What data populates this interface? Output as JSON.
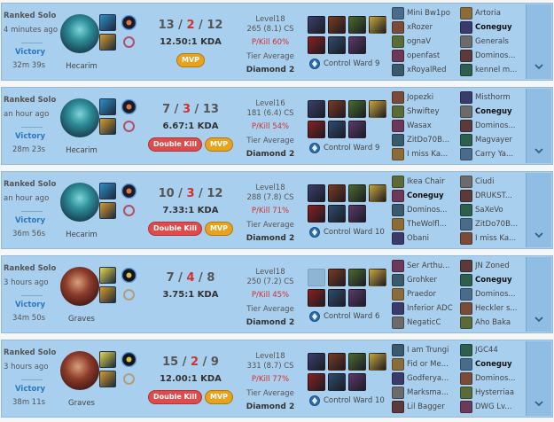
{
  "colors": {
    "win_bg": "#a9cfee",
    "victory": "#2c76c3",
    "deaths": "#d32f2f",
    "kill_participation": "#d32f2f",
    "mvp_badge": "#e9a21c",
    "multikill_badge": "#e04a4a"
  },
  "matches": [
    {
      "queue": "Ranked Solo",
      "time_ago": "4 minutes ago",
      "result": "Victory",
      "duration": "32m 39s",
      "champion": "Hecarim",
      "spells": [
        "ghost-spell-icon",
        "smite-spell-icon"
      ],
      "runes": [
        "conqueror-rune-icon",
        "sorcery-rune-icon"
      ],
      "kills": "13",
      "deaths": "2",
      "assists": "12",
      "kda": "12.50:1 KDA",
      "badges": [
        {
          "label": "MVP",
          "type": "mvp"
        }
      ],
      "level": "Level18",
      "cs": "265 (8.1) CS",
      "pkill": "P/Kill 60%",
      "tier_label": "Tier Average",
      "tier": "Diamond 2",
      "items": [
        "item-1-icon",
        "item-2-icon",
        "item-3-icon",
        "trinket-icon",
        "item-4-icon",
        "item-5-icon",
        "item-6-icon"
      ],
      "ward": "Control Ward 9",
      "team1": [
        "Mini Bw1po",
        "xRozer",
        "ognaV",
        "openfast",
        "xRoyalRed"
      ],
      "team2": [
        "Ártoria",
        "Coneguy",
        "Generals",
        "Dominos...",
        "kennel m..."
      ]
    },
    {
      "queue": "Ranked Solo",
      "time_ago": "an hour ago",
      "result": "Victory",
      "duration": "28m 23s",
      "champion": "Hecarim",
      "spells": [
        "ghost-spell-icon",
        "smite-spell-icon"
      ],
      "runes": [
        "conqueror-rune-icon",
        "sorcery-rune-icon"
      ],
      "kills": "7",
      "deaths": "3",
      "assists": "13",
      "kda": "6.67:1 KDA",
      "badges": [
        {
          "label": "Double Kill",
          "type": "multi"
        },
        {
          "label": "MVP",
          "type": "mvp"
        }
      ],
      "level": "Level16",
      "cs": "181 (6.4) CS",
      "pkill": "P/Kill 54%",
      "tier_label": "Tier Average",
      "tier": "Diamond 2",
      "items": [
        "item-1-icon",
        "item-2-icon",
        "item-3-icon",
        "trinket-icon",
        "item-4-icon",
        "item-5-icon",
        "item-6-icon"
      ],
      "ward": "Control Ward 9",
      "team1": [
        "Jopezki",
        "Shwiftey",
        "Wasax",
        "ŽitDo70B...",
        "I miss Ka..."
      ],
      "team2": [
        "Misthorm",
        "Coneguy",
        "Dominos...",
        "Magvayer",
        "Carry Ya..."
      ]
    },
    {
      "queue": "Ranked Solo",
      "time_ago": "an hour ago",
      "result": "Victory",
      "duration": "36m 56s",
      "champion": "Hecarim",
      "spells": [
        "ghost-spell-icon",
        "smite-spell-icon"
      ],
      "runes": [
        "conqueror-rune-icon",
        "sorcery-rune-icon"
      ],
      "kills": "10",
      "deaths": "3",
      "assists": "12",
      "kda": "7.33:1 KDA",
      "badges": [
        {
          "label": "Double Kill",
          "type": "multi"
        },
        {
          "label": "MVP",
          "type": "mvp"
        }
      ],
      "level": "Level18",
      "cs": "288 (7.8) CS",
      "pkill": "P/Kill 71%",
      "tier_label": "Tier Average",
      "tier": "Diamond 2",
      "items": [
        "item-1-icon",
        "item-2-icon",
        "item-3-icon",
        "trinket-icon",
        "item-4-icon",
        "item-5-icon",
        "item-6-icon"
      ],
      "ward": "Control Ward 10",
      "team1": [
        "Ikea Chair",
        "Coneguy",
        "Dominos...",
        "TheWolfl...",
        "Obani"
      ],
      "team2": [
        "Ciudi",
        "DRUKST...",
        "SaXeVo",
        "ŽitDo70B...",
        "I miss Ka..."
      ]
    },
    {
      "queue": "Ranked Solo",
      "time_ago": "3 hours ago",
      "result": "Victory",
      "duration": "34m 50s",
      "champion": "Graves",
      "spells": [
        "flash-spell-icon",
        "smite-spell-icon"
      ],
      "runes": [
        "fleet-rune-icon",
        "precision-rune-icon"
      ],
      "kills": "7",
      "deaths": "4",
      "assists": "8",
      "kda": "3.75:1 KDA",
      "badges": [],
      "level": "Level18",
      "cs": "250 (7.2) CS",
      "pkill": "P/Kill 45%",
      "tier_label": "Tier Average",
      "tier": "Diamond 2",
      "items": [
        "empty",
        "item-2-icon",
        "item-3-icon",
        "trinket-icon",
        "item-4-icon",
        "item-5-icon",
        "item-6-icon"
      ],
      "ward": "Control Ward 6",
      "team1": [
        "Ser Arthu...",
        "Grohker",
        "Praedor",
        "Inferior ADC",
        "NegaticC"
      ],
      "team2": [
        "JN Zoned",
        "Coneguy",
        "Dominos...",
        "Heckler s...",
        "Aho Baka"
      ]
    },
    {
      "queue": "Ranked Solo",
      "time_ago": "3 hours ago",
      "result": "Victory",
      "duration": "38m 11s",
      "champion": "Graves",
      "spells": [
        "flash-spell-icon",
        "smite-spell-icon"
      ],
      "runes": [
        "fleet-rune-icon",
        "precision-rune-icon"
      ],
      "kills": "15",
      "deaths": "2",
      "assists": "9",
      "kda": "12.00:1 KDA",
      "badges": [
        {
          "label": "Double Kill",
          "type": "multi"
        },
        {
          "label": "MVP",
          "type": "mvp"
        }
      ],
      "level": "Level18",
      "cs": "331 (8.7) CS",
      "pkill": "P/Kill 77%",
      "tier_label": "Tier Average",
      "tier": "Diamond 2",
      "items": [
        "item-1-icon",
        "item-2-icon",
        "item-3-icon",
        "trinket-icon",
        "item-4-icon",
        "item-5-icon",
        "item-6-icon"
      ],
      "ward": "Control Ward 10",
      "team1": [
        "I am Trungi",
        "Fid or Me...",
        "Godferya...",
        "Marksma...",
        "Lil Bagger"
      ],
      "team2": [
        "JGC44",
        "Coneguy",
        "Dominos...",
        "Hysterriaa",
        "DWG Lv..."
      ]
    }
  ]
}
